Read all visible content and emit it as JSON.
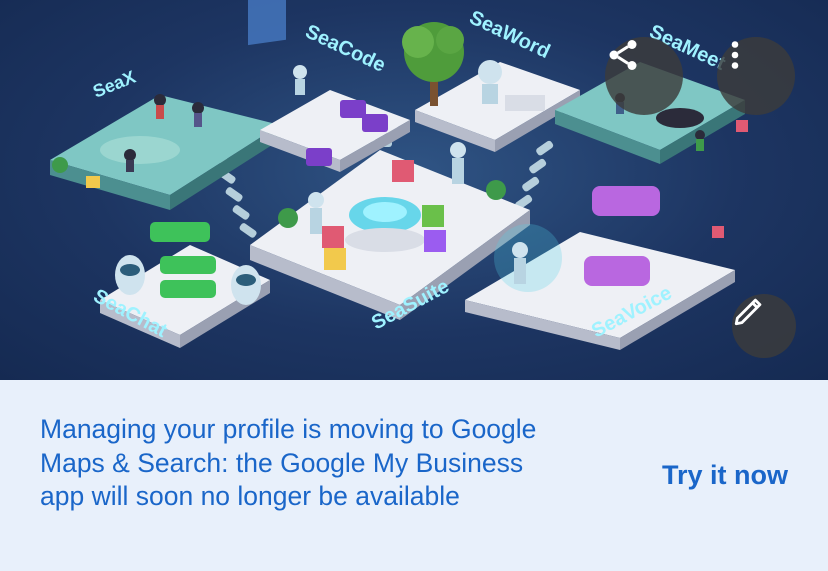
{
  "hero": {
    "platform_labels": {
      "seax": "SeaX",
      "seacode": "SeaCode",
      "seaword": "SeaWord",
      "seameet": "SeaMeet",
      "seachat": "SeaChat",
      "seasuite": "SeaSuite",
      "seavoice": "SeaVoice"
    },
    "icons": {
      "share": "share-icon",
      "more": "more-vertical-icon",
      "edit": "pencil-icon"
    }
  },
  "banner": {
    "message": "Managing your profile is moving to Google Maps & Search: the Google My Business app will soon no longer be available",
    "cta_label": "Try it now"
  },
  "colors": {
    "link_blue": "#1a66c9",
    "banner_bg": "#e8f0fb",
    "hero_bg": "#1d3562"
  }
}
